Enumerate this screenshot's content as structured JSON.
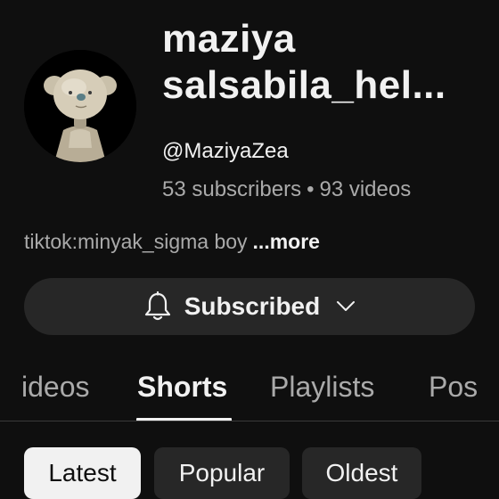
{
  "channel": {
    "name_line1": "maziya",
    "name_line2": "salsabila_hel...",
    "handle": "@MaziyaZea",
    "subscribers": "53 subscribers",
    "separator": "•",
    "videos": "93 videos",
    "description": "tiktok:minyak_sigma boy",
    "more_label": "...more"
  },
  "subscribe": {
    "label": "Subscribed",
    "bell_icon": "bell-icon",
    "chevron_icon": "chevron-down-icon"
  },
  "tabs": [
    {
      "label": "ideos",
      "active": false
    },
    {
      "label": "Shorts",
      "active": true
    },
    {
      "label": "Playlists",
      "active": false
    },
    {
      "label": "Pos",
      "active": false
    }
  ],
  "chips": [
    {
      "label": "Latest",
      "selected": true
    },
    {
      "label": "Popular",
      "selected": false
    },
    {
      "label": "Oldest",
      "selected": false
    }
  ],
  "colors": {
    "background": "#0f0f0f",
    "primary_text": "#f1f1f1",
    "secondary_text": "#aaaaaa",
    "button_bg": "#272727"
  }
}
